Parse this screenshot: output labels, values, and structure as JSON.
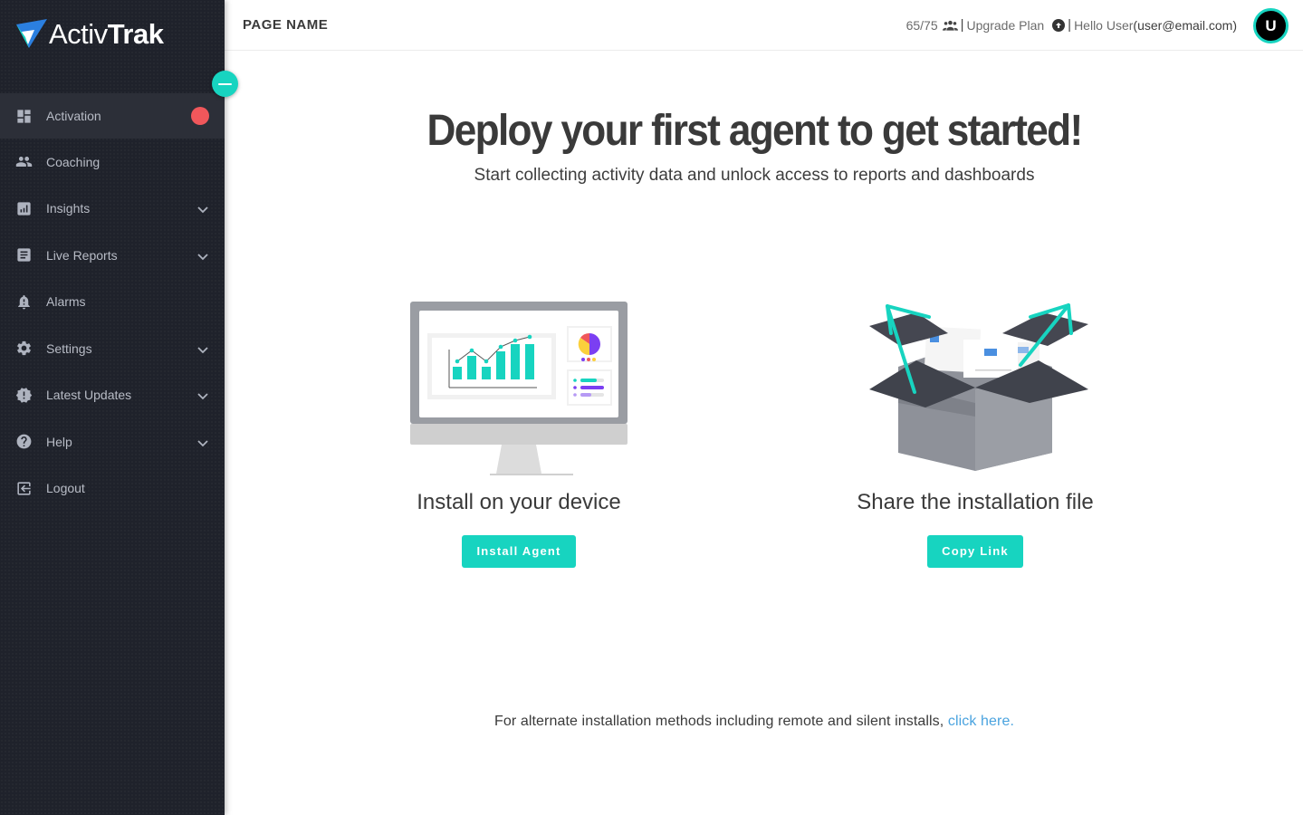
{
  "brand": {
    "name_light": "Activ",
    "name_bold": "Trak",
    "accent_color": "#17d4c0",
    "logo_blue": "#2b7fe0"
  },
  "sidebar": {
    "collapse_button": "collapse-sidebar",
    "items": [
      {
        "label": "Activation",
        "icon": "dashboard-icon",
        "active": true,
        "badge": "red-dot",
        "expandable": false
      },
      {
        "label": "Coaching",
        "icon": "people-icon",
        "active": false,
        "expandable": false
      },
      {
        "label": "Insights",
        "icon": "bar-chart-icon",
        "active": false,
        "expandable": true
      },
      {
        "label": "Live Reports",
        "icon": "report-icon",
        "active": false,
        "expandable": true
      },
      {
        "label": "Alarms",
        "icon": "bell-alert-icon",
        "active": false,
        "expandable": false
      },
      {
        "label": "Settings",
        "icon": "gear-icon",
        "active": false,
        "expandable": true
      },
      {
        "label": "Latest Updates",
        "icon": "alert-badge-icon",
        "active": false,
        "expandable": true
      },
      {
        "label": "Help",
        "icon": "help-circle-icon",
        "active": false,
        "expandable": true
      },
      {
        "label": "Logout",
        "icon": "logout-icon",
        "active": false,
        "expandable": false
      }
    ]
  },
  "header": {
    "page_name": "PAGE NAME",
    "license_count": "65/75",
    "upgrade_label": "Upgrade Plan",
    "greeting": "Hello User",
    "email": "(user@email.com)",
    "avatar_initial": "U"
  },
  "main": {
    "title": "Deploy your first agent to get started!",
    "subtitle": "Start collecting activity data and unlock access to reports and dashboards",
    "cards": [
      {
        "title": "Install on your device",
        "button": "Install Agent",
        "illustration": "monitor-dashboard-illustration"
      },
      {
        "title": "Share the installation file",
        "button": "Copy Link",
        "illustration": "open-box-share-illustration"
      }
    ],
    "alt_text": "For alternate installation methods including remote and silent installs, ",
    "alt_link": "click here."
  }
}
